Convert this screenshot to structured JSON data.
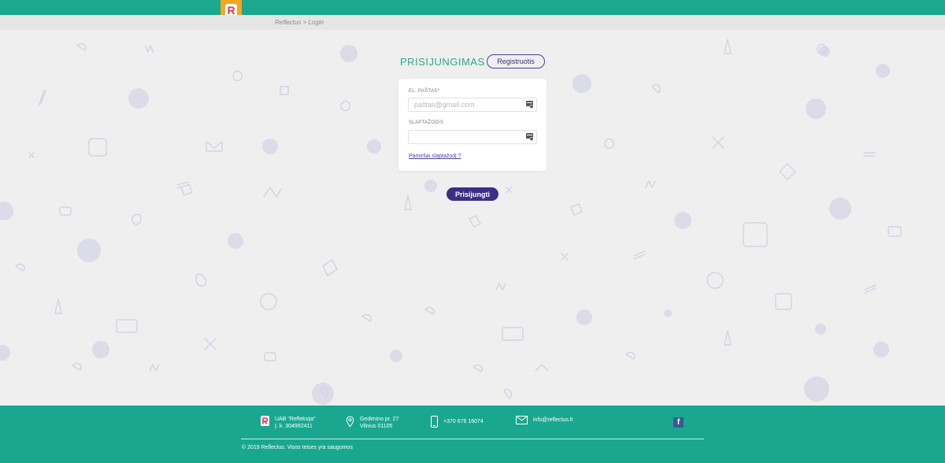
{
  "header": {
    "logo_letter": "R",
    "breadcrumb": "Reflectus > Login"
  },
  "login": {
    "heading": "PRISIJUNGIMAS",
    "register_label": "Registruotis",
    "email_label": "EL. PAŠTAS*",
    "email_placeholder": "paštas@gmail.com",
    "email_value": "",
    "password_label": "SLAPTAŽODIS",
    "password_value": "",
    "forgot_label": "Pamiršai slaptažodį ?",
    "submit_label": "Prisijungti"
  },
  "footer": {
    "company_line1": "UAB \"Refleksija\"",
    "company_line2": "Į. k. 304992411",
    "address_line1": "Gedimino pr. 27",
    "address_line2": "Vilnius 01105",
    "phone": "+370 676 16074",
    "email": "info@reflectus.lt",
    "copyright": "© 2019 Reflectus. Visos teises yra saugomos",
    "social_icon": "facebook-icon"
  },
  "colors": {
    "teal": "#1aa88e",
    "purple": "#3e2d86",
    "logo_orange": "#f5a623",
    "background": "#efefef"
  }
}
